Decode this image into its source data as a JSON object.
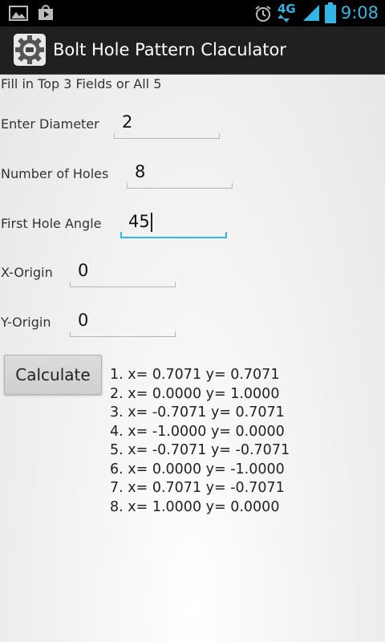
{
  "status_bar": {
    "time": "9:08",
    "network": "4G",
    "icons": [
      "image-icon",
      "play-store-icon",
      "alarm-icon",
      "signal-icon",
      "battery-icon"
    ]
  },
  "app": {
    "title": "Bolt Hole Pattern Claculator",
    "icon": "gear-icon"
  },
  "form": {
    "instructions": "Fill in Top 3 Fields or All 5",
    "diameter": {
      "label": "Enter Diameter",
      "value": "2"
    },
    "holes": {
      "label": "Number of Holes",
      "value": "8"
    },
    "angle": {
      "label": "First Hole Angle",
      "value": "45"
    },
    "x_origin": {
      "label": "X-Origin",
      "value": "0"
    },
    "y_origin": {
      "label": "Y-Origin",
      "value": "0"
    }
  },
  "calculate_label": "Calculate",
  "results": [
    "1. x= 0.7071 y= 0.7071",
    "2. x= 0.0000 y= 1.0000",
    "3. x= -0.7071 y= 0.7071",
    "4. x= -1.0000 y= 0.0000",
    "5. x= -0.7071 y= -0.7071",
    "6. x= 0.0000 y= -1.0000",
    "7. x= 0.7071 y= -0.7071",
    "8. x= 1.0000 y= 0.0000"
  ],
  "colors": {
    "accent": "#33b5e5",
    "action_bar": "#202020",
    "status_bar": "#000000"
  }
}
